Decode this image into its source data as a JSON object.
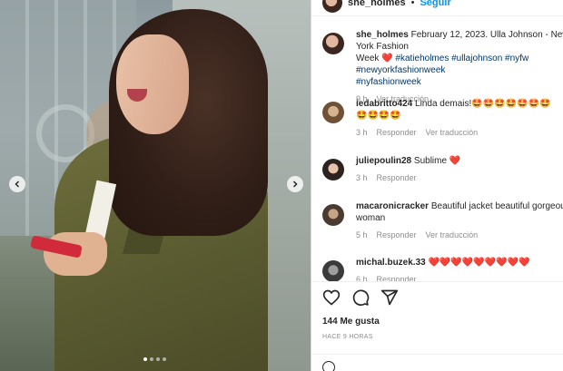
{
  "post": {
    "author": "she_holmes",
    "follow_label": "Seguir",
    "caption_author": "she_holmes",
    "caption_line1": "February 12, 2023. Ulla Johnson - New York Fashion",
    "caption_line2_start": "Week ",
    "caption_line2_heart": "❤️",
    "caption_hashtags": "#katieholmes #ullajohnson #nyfw #newyorkfashionweek",
    "caption_hashtag_line3": "#nyfashionweek",
    "caption_time": "9 h",
    "caption_translate": "Ver traducción"
  },
  "comments": [
    {
      "user": "iedabritto424",
      "text": "Linda demais!",
      "emojis_line1": "🤩🤩🤩🤩🤩🤩🤩",
      "emojis_line2": "🤩🤩🤩🤩",
      "time": "3 h",
      "reply": "Responder",
      "translate": "Ver traducción"
    },
    {
      "user": "juliepoulin28",
      "text": "Sublime",
      "emoji": "❤️",
      "time": "3 h",
      "reply": "Responder"
    },
    {
      "user": "macaronicracker",
      "text": "Beautiful jacket beautiful gorgeous",
      "text_line2": "woman",
      "time": "5 h",
      "reply": "Responder",
      "translate": "Ver traducción"
    },
    {
      "user": "michal.buzek.33",
      "emojis": "❤️❤️❤️❤️❤️❤️❤️❤️❤️",
      "time": "6 h",
      "reply": "Responder"
    }
  ],
  "stats": {
    "likes": "144 Me gusta",
    "posted_ago": "HACE 9 HORAS"
  },
  "carousel": {
    "total_slides": 4,
    "active_slide": 1
  },
  "icons": [
    "chevron-left-icon",
    "chevron-right-icon",
    "heart-icon",
    "comment-icon",
    "share-icon",
    "emoji-icon"
  ],
  "colors": {
    "link": "#0095f6",
    "hashtag": "#00376b",
    "muted": "#8e8e8e",
    "text": "#262626"
  }
}
